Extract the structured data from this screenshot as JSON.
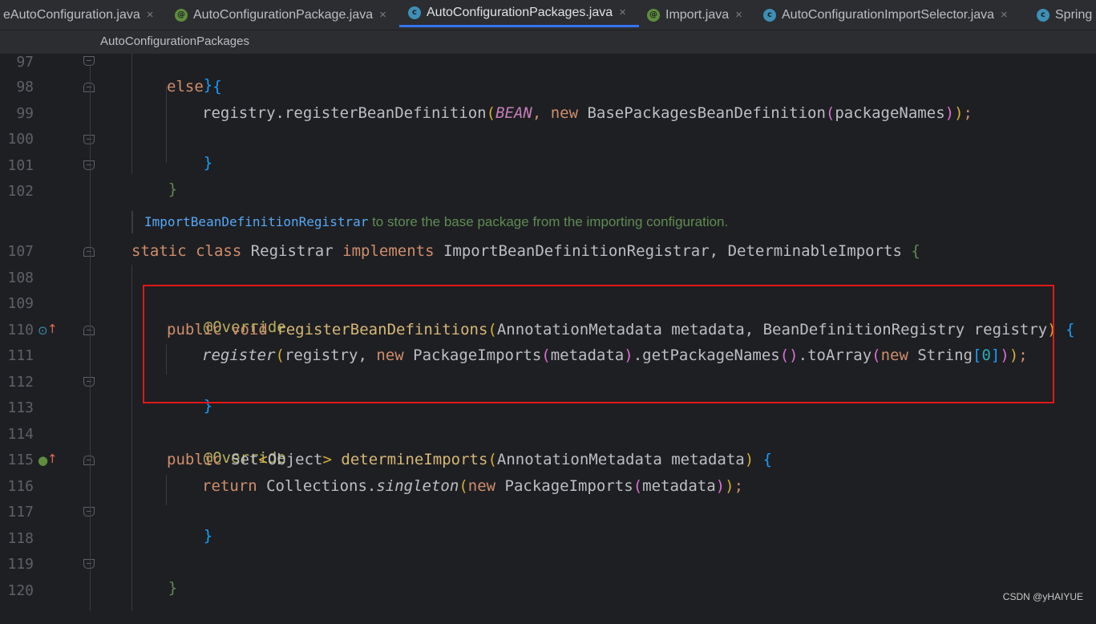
{
  "tabs": [
    {
      "label": "eAutoConfiguration.java",
      "icon": "none",
      "active": false
    },
    {
      "label": "AutoConfigurationPackage.java",
      "icon": "annotation-icon",
      "active": false
    },
    {
      "label": "AutoConfigurationPackages.java",
      "icon": "class-icon",
      "active": true
    },
    {
      "label": "Import.java",
      "icon": "annotation-icon",
      "active": false
    },
    {
      "label": "AutoConfigurationImportSelector.java",
      "icon": "class-icon",
      "active": false
    },
    {
      "label": "Spring",
      "icon": "class-icon",
      "active": false
    }
  ],
  "tab_close_glyph": "×",
  "breadcrumb": "AutoConfigurationPackages",
  "line_numbers": [
    "97",
    "98",
    "99",
    "100",
    "101",
    "102",
    "107",
    "108",
    "109",
    "110",
    "111",
    "112",
    "113",
    "114",
    "115",
    "116",
    "117",
    "118",
    "119",
    "120"
  ],
  "doc_comment": {
    "link": "ImportBeanDefinitionRegistrar",
    "text": " to store the base package from the importing configuration."
  },
  "code": {
    "l97": {
      "brace": "}"
    },
    "l98": {
      "kw": "else",
      "brace": "{"
    },
    "l99": {
      "t1": "registry.registerBeanDefinition",
      "p1": "(",
      "const": "BEAN",
      "t2": ", ",
      "kw": "new",
      "t3": " BasePackagesBeanDefinition",
      "p2": "(",
      "t4": "packageNames",
      "p3": ")",
      "p4": ")",
      "end": ";"
    },
    "l100": {
      "brace": "}"
    },
    "l101": {
      "brace": "}"
    },
    "l107": {
      "kw1": "static class",
      "t1": " Registrar ",
      "kw2": "implements",
      "t2": " ImportBeanDefinitionRegistrar, DeterminableImports ",
      "brace": "{"
    },
    "l109": {
      "ann": "@Override"
    },
    "l110": {
      "kw": "public void",
      "fn": "registerBeanDefinitions",
      "p1": "(",
      "t1": "AnnotationMetadata metadata, BeanDefinitionRegistry registry",
      "p2": ")",
      "brace": "{"
    },
    "l111": {
      "call": "register",
      "p1": "(",
      "t1": "registry, ",
      "kw1": "new",
      "t2": " PackageImports",
      "p2": "(",
      "t3": "metadata",
      "p3": ")",
      "t4": ".getPackageNames",
      "p4": "()",
      "t5": ".toArray",
      "p5": "(",
      "kw2": "new",
      "t6": " String",
      "b1": "[",
      "num": "0",
      "b2": "]",
      "p6": ")",
      "p7": ")",
      "end": ";"
    },
    "l112": {
      "brace": "}"
    },
    "l114": {
      "ann": "@Override"
    },
    "l115": {
      "kw": "public",
      "t1": " Set",
      "lt": "<",
      "t2": "Object",
      "gt": ">",
      "fn": "determineImports",
      "p1": "(",
      "t3": "AnnotationMetadata metadata",
      "p2": ")",
      "brace": "{"
    },
    "l116": {
      "kw1": "return",
      "t1": " Collections.",
      "call": "singleton",
      "p1": "(",
      "kw2": "new",
      "t2": " PackageImports",
      "p2": "(",
      "t3": "metadata",
      "p3": ")",
      "p4": ")",
      "end": ";"
    },
    "l117": {
      "brace": "}"
    },
    "l119": {
      "brace": "}"
    }
  },
  "watermark": "CSDN @yHAIYUE",
  "colors": {
    "accent": "#3574f0",
    "highlight_border": "#e01818",
    "keyword": "#cf8e6d",
    "method": "#56a8f5",
    "annotation": "#b3ae60"
  }
}
